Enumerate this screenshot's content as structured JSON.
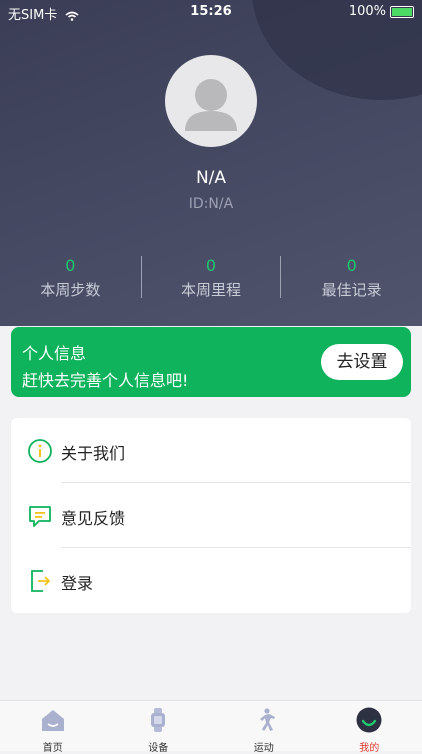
{
  "status_bar": {
    "carrier": "无SIM卡",
    "time": "15:26",
    "battery": "100%"
  },
  "profile": {
    "name": "N/A",
    "id": "ID:N/A"
  },
  "stats": [
    {
      "value": "0",
      "label": "本周步数"
    },
    {
      "value": "0",
      "label": "本周里程"
    },
    {
      "value": "0",
      "label": "最佳记录"
    }
  ],
  "banner": {
    "title": "个人信息",
    "subtitle": "赶快去完善个人信息吧!",
    "button": "去设置"
  },
  "menu": [
    {
      "label": "关于我们",
      "icon": "info-circle-icon"
    },
    {
      "label": "意见反馈",
      "icon": "feedback-chat-icon"
    },
    {
      "label": "登录",
      "icon": "login-icon"
    }
  ],
  "tabs": [
    {
      "label": "首页",
      "icon": "home-icon"
    },
    {
      "label": "设备",
      "icon": "watch-icon"
    },
    {
      "label": "运动",
      "icon": "running-icon"
    },
    {
      "label": "我的",
      "icon": "profile-icon",
      "active": true
    }
  ],
  "colors": {
    "accent": "#0eb35c",
    "header": "#3e4159",
    "active_tab": "#e23b2f"
  }
}
